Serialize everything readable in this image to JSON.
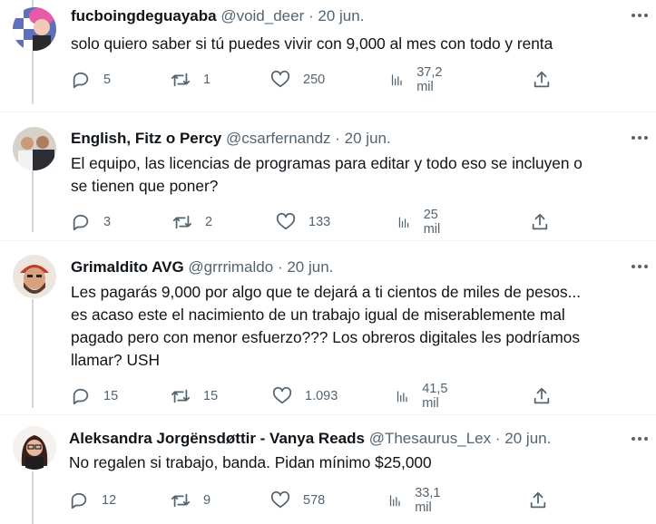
{
  "tweets": [
    {
      "name": "fucboingdeguayaba",
      "handle": "@void_deer",
      "date": "20 jun.",
      "lines": [
        "solo quiero saber si tú puedes vivir con 9,000 al mes con todo y renta"
      ],
      "replies": "5",
      "retweets": "1",
      "likes": "250",
      "views": "37,2 mil"
    },
    {
      "name": "English, Fitz o Percy",
      "handle": "@csarfernandz",
      "date": "20 jun.",
      "lines": [
        "El equipo, las licencias de programas para editar y todo eso se incluyen o",
        "se tienen que poner?"
      ],
      "replies": "3",
      "retweets": "2",
      "likes": "133",
      "views": "25 mil"
    },
    {
      "name": "Grimaldito AVG",
      "handle": "@grrrimaldo",
      "date": "20 jun.",
      "lines": [
        "Les pagarás 9,000 por algo que te dejará a ti cientos de miles de pesos...",
        "es acaso este el nacimiento de un trabajo igual de miserablemente mal",
        "pagado pero con menor esfuerzo??? Los obreros digitales les podríamos",
        "llamar?  USH"
      ],
      "replies": "15",
      "retweets": "15",
      "likes": "1.093",
      "views": "41,5 mil"
    },
    {
      "name": "Aleksandra Jorgënsdøttir - Vanya Reads",
      "handle": "@Thesaurus_Lex",
      "date": "20 jun.",
      "lines": [
        "No regalen si trabajo, banda. Pidan mínimo $25,000"
      ],
      "replies": "12",
      "retweets": "9",
      "likes": "578",
      "views": "33,1 mil"
    }
  ],
  "separator": "·",
  "icons": {
    "reply": "reply-icon",
    "retweet": "retweet-icon",
    "like": "heart-icon",
    "views": "views-icon",
    "share": "share-icon",
    "more": "more-icon"
  },
  "colors": {
    "muted": "#536471",
    "thread_line": "#cfd9de",
    "divider": "#eff3f4"
  }
}
